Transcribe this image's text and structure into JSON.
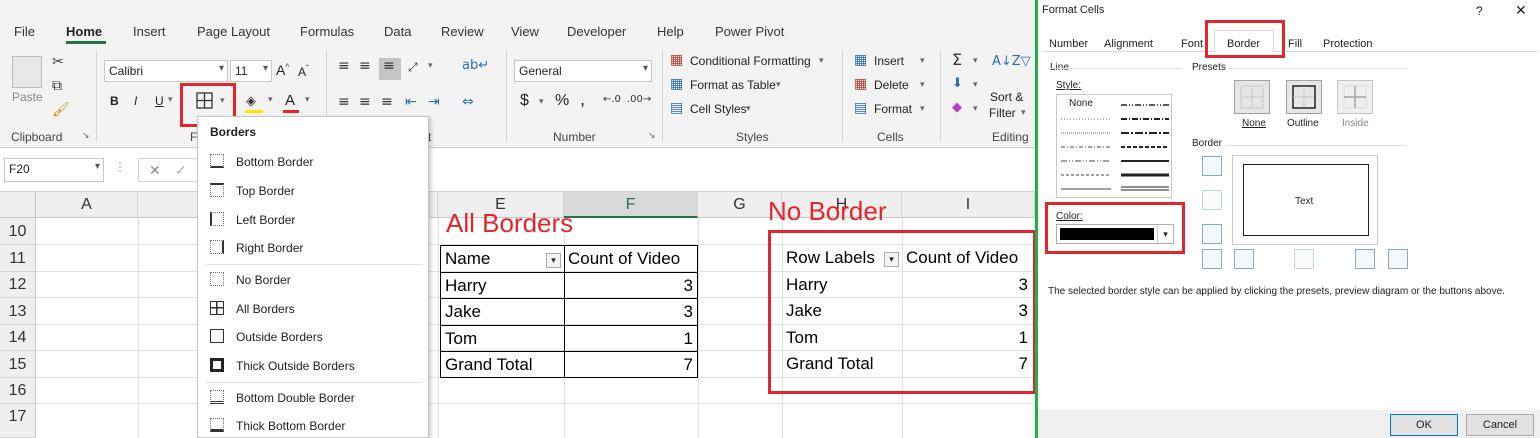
{
  "ribbon": {
    "tabs": [
      "File",
      "Home",
      "Insert",
      "Page Layout",
      "Formulas",
      "Data",
      "Review",
      "View",
      "Developer",
      "Help",
      "Power Pivot"
    ],
    "paste_label": "Paste",
    "font_name": "Calibri",
    "font_size": "11",
    "number_format": "General",
    "conditional_formatting": "Conditional Formatting",
    "format_as_table": "Format as Table",
    "cell_styles": "Cell Styles",
    "insert": "Insert",
    "delete": "Delete",
    "format": "Format",
    "sort_filter_line1": "Sort &",
    "sort_filter_line2": "Filter",
    "groups": {
      "clipboard": "Clipboard",
      "font_fragment": "F",
      "alignment_fragment": "t",
      "number": "Number",
      "styles": "Styles",
      "cells": "Cells",
      "editing": "Editing"
    },
    "bold": "B",
    "italic": "I",
    "underline": "U",
    "percent": "%",
    "dollar": "$",
    "comma": ","
  },
  "formula_bar": {
    "name_box": "F20",
    "cancel": "✕",
    "enter": "✓"
  },
  "grid": {
    "columns": [
      "A",
      "E",
      "F",
      "G",
      "H",
      "I"
    ],
    "rows": [
      "10",
      "11",
      "12",
      "13",
      "14",
      "15",
      "16",
      "17"
    ]
  },
  "borders_menu": {
    "title": "Borders",
    "items": [
      "Bottom Border",
      "Top Border",
      "Left Border",
      "Right Border",
      "No Border",
      "All Borders",
      "Outside Borders",
      "Thick Outside Borders",
      "Bottom Double Border",
      "Thick Bottom Border"
    ]
  },
  "annotations": {
    "all_borders": "All Borders",
    "no_border": "No Border"
  },
  "table_all": {
    "headers": [
      "Name",
      "Count of Video"
    ],
    "rows": [
      [
        "Harry",
        "3"
      ],
      [
        "Jake",
        "3"
      ],
      [
        "Tom",
        "1"
      ],
      [
        "Grand Total",
        "7"
      ]
    ]
  },
  "table_none": {
    "headers": [
      "Row Labels",
      "Count of Video"
    ],
    "rows": [
      [
        "Harry",
        "3"
      ],
      [
        "Jake",
        "3"
      ],
      [
        "Tom",
        "1"
      ],
      [
        "Grand Total",
        "7"
      ]
    ]
  },
  "dialog": {
    "title": "Format Cells",
    "help": "?",
    "close": "✕",
    "tabs": [
      "Number",
      "Alignment",
      "Font",
      "Border",
      "Fill",
      "Protection"
    ],
    "line_label": "Line",
    "style_label": "Style:",
    "none_style": "None",
    "color_label": "Color:",
    "presets_label": "Presets",
    "preset_none": "None",
    "preset_outline": "Outline",
    "preset_inside": "Inside",
    "border_label": "Border",
    "preview_text": "Text",
    "hint": "The selected border style can be applied by clicking the presets, preview diagram or the buttons above.",
    "ok": "OK",
    "cancel": "Cancel"
  },
  "colors": {
    "accent": "#217346",
    "highlight": "#e3262b",
    "divider": "#20b14a"
  }
}
